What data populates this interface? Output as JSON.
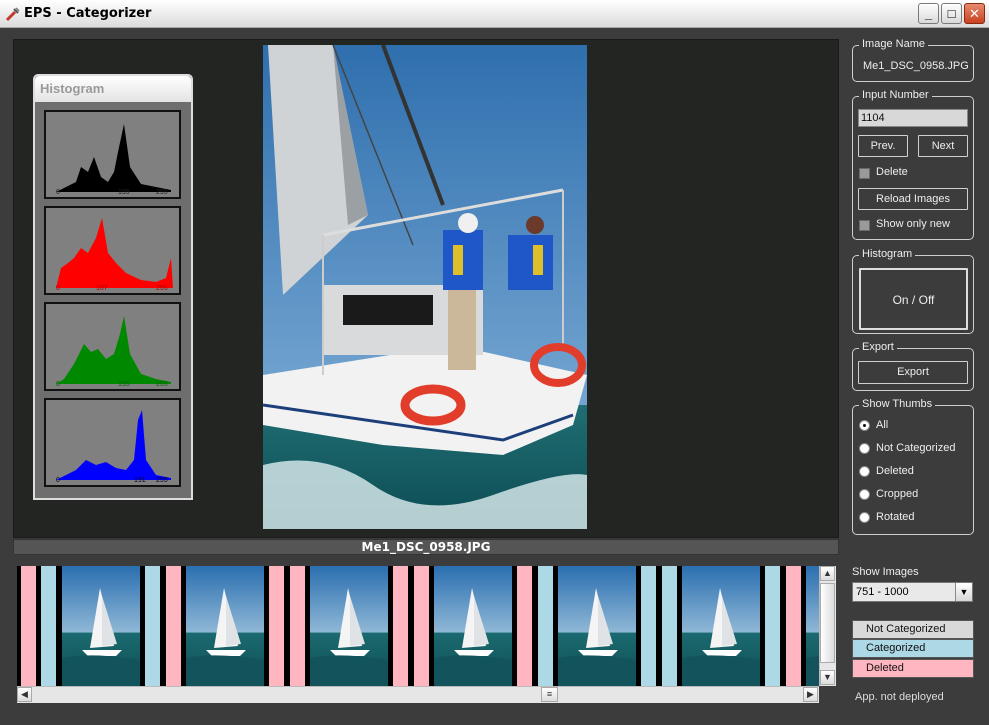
{
  "window": {
    "title": "EPS - Categorizer"
  },
  "viewer": {
    "caption": "Me1_DSC_0958.JPG"
  },
  "histogram_panel": {
    "title": "Histogram",
    "channels": [
      {
        "name": "luminance",
        "color": "#000000",
        "ticks": [
          "0",
          "155",
          "255"
        ]
      },
      {
        "name": "red",
        "color": "#ff0000",
        "ticks": [
          "0",
          "107",
          "255"
        ]
      },
      {
        "name": "green",
        "color": "#008800",
        "ticks": [
          "0",
          "155",
          "255"
        ]
      },
      {
        "name": "blue",
        "color": "#0000ff",
        "ticks": [
          "0",
          "191",
          "255"
        ]
      }
    ]
  },
  "image_name": {
    "legend": "Image Name",
    "value": "Me1_DSC_0958.JPG"
  },
  "input_number": {
    "legend": "Input Number",
    "value": "1104",
    "prev_label": "Prev.",
    "next_label": "Next",
    "delete_label": "Delete",
    "reload_label": "Reload Images",
    "show_only_new_label": "Show only new"
  },
  "histogram_toggle": {
    "legend": "Histogram",
    "button_label": "On / Off"
  },
  "export": {
    "legend": "Export",
    "button_label": "Export"
  },
  "show_thumbs": {
    "legend": "Show Thumbs",
    "options": [
      "All",
      "Not Categorized",
      "Deleted",
      "Cropped",
      "Rotated"
    ],
    "selected": "All"
  },
  "show_images": {
    "label": "Show Images",
    "selected": "751 - 1000"
  },
  "status_legend": [
    {
      "label": "Not Categorized",
      "color": "#d9d9d9"
    },
    {
      "label": "Categorized",
      "color": "#add8e6"
    },
    {
      "label": "Deleted",
      "color": "#ffb6c1"
    }
  ],
  "status_text": "App. not deployed"
}
